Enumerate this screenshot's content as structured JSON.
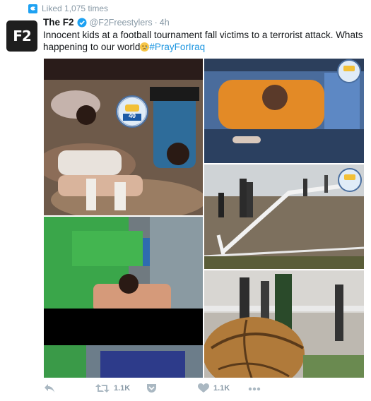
{
  "context": {
    "text": "Liked 1,075 times",
    "icon": "liked-bird-icon"
  },
  "user": {
    "avatar_text": "F2",
    "name": "The F2",
    "handle": "@F2Freestylers",
    "separator": "·",
    "time": "4h"
  },
  "tweet": {
    "text": "Innocent kids at a football tournament fall victims to a terrorist attack. Whats happening to our world",
    "emoji": "crying-face-emoji",
    "hashtag": "#PrayForIraq"
  },
  "media": {
    "badge_number": "40"
  },
  "actions": {
    "reply": {
      "icon": "reply-icon"
    },
    "retweet": {
      "icon": "retweet-icon",
      "count": "1.1K"
    },
    "pocket": {
      "icon": "pocket-icon"
    },
    "like": {
      "icon": "heart-icon",
      "count": "1.1K"
    },
    "more": {
      "icon": "more-icon"
    }
  },
  "colors": {
    "link": "#1b95e0",
    "muted": "#8899a6",
    "text": "#14171a",
    "verified": "#1da1f2",
    "action": "#aab8c2"
  }
}
